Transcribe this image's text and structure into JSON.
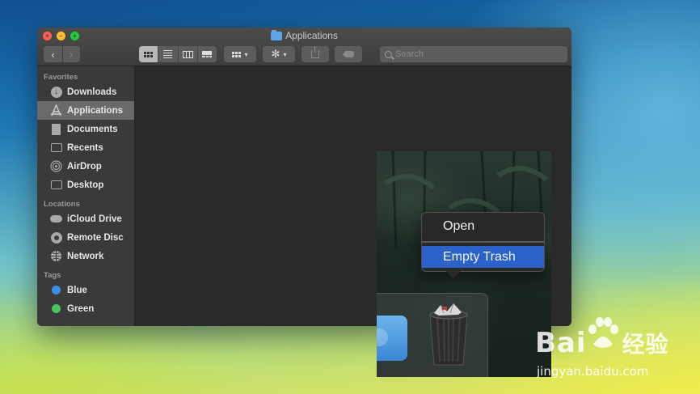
{
  "window": {
    "title": "Applications",
    "search_placeholder": "Search"
  },
  "toolbar": {
    "back_label": "‹",
    "forward_label": "›",
    "group_caret": "▾",
    "action_icon": "✻",
    "action_caret": "▾",
    "share_label": ""
  },
  "sidebar": {
    "favorites_header": "Favorites",
    "favorites": [
      {
        "label": "Downloads",
        "icon": "download-icon"
      },
      {
        "label": "Applications",
        "icon": "applications-icon",
        "active": true
      },
      {
        "label": "Documents",
        "icon": "document-icon"
      },
      {
        "label": "Recents",
        "icon": "recents-icon"
      },
      {
        "label": "AirDrop",
        "icon": "airdrop-icon"
      },
      {
        "label": "Desktop",
        "icon": "desktop-icon"
      }
    ],
    "locations_header": "Locations",
    "locations": [
      {
        "label": "iCloud Drive",
        "icon": "cloud-icon"
      },
      {
        "label": "Remote Disc",
        "icon": "disc-icon"
      },
      {
        "label": "Network",
        "icon": "network-icon"
      }
    ],
    "tags_header": "Tags",
    "tags": [
      {
        "label": "Blue",
        "color": "#3b8fe8"
      },
      {
        "label": "Green",
        "color": "#47c65a"
      }
    ]
  },
  "context_menu": {
    "open_label": "Open",
    "empty_trash_label": "Empty Trash",
    "highlight_color": "#2a62c9"
  },
  "watermark": {
    "logo_text": "Bai",
    "logo_text2": "经验",
    "url": "jingyan.baidu.com"
  }
}
